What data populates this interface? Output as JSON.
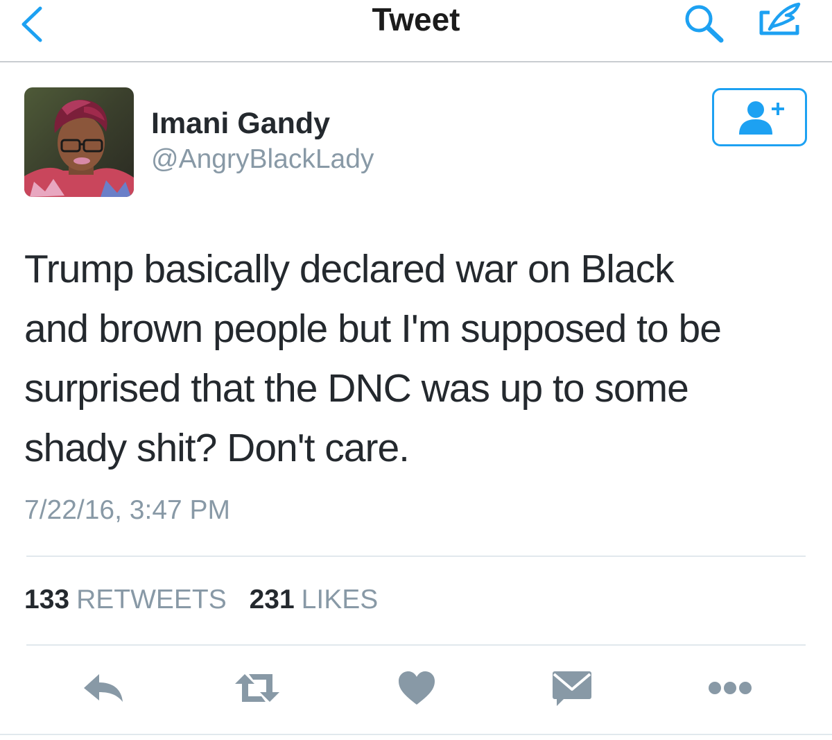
{
  "navbar": {
    "title": "Tweet",
    "back_icon": "chevron-left-icon",
    "search_icon": "search-icon",
    "compose_icon": "compose-icon"
  },
  "author": {
    "name": "Imani Gandy",
    "handle": "@AngryBlackLady",
    "follow_icon": "add-user-icon"
  },
  "tweet": {
    "lines": [
      "Trump basically declared war on Black",
      "and brown people but I'm supposed to be",
      "surprised that the DNC was up to some",
      "shady shit? Don't care."
    ],
    "timestamp": "7/22/16, 3:47 PM"
  },
  "stats": {
    "retweets_count": "133",
    "retweets_label": "RETWEETS",
    "likes_count": "231",
    "likes_label": "LIKES"
  },
  "actions": [
    "reply-icon",
    "retweet-icon",
    "like-icon",
    "direct-message-icon",
    "more-icon"
  ],
  "colors": {
    "accent": "#1da1f2",
    "icon_gray": "#8899a6",
    "text": "#24292e",
    "secondary_text": "#8899a6",
    "divider": "#e1e8ed"
  }
}
